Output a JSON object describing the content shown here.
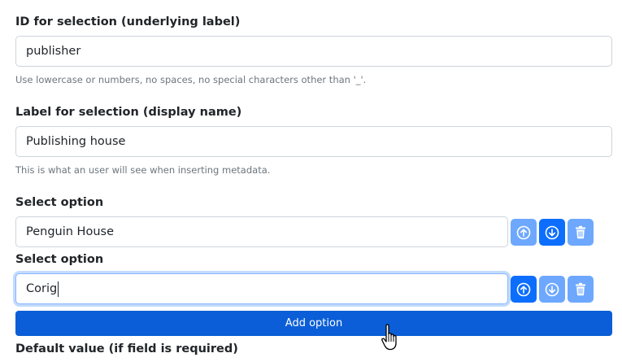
{
  "id_section": {
    "label": "ID for selection (underlying label)",
    "value": "publisher",
    "help": "Use lowercase or numbers, no spaces, no special characters other than '_'."
  },
  "label_section": {
    "label": "Label for selection (display name)",
    "value": "Publishing house",
    "help": "This is what an user will see when inserting metadata."
  },
  "options": [
    {
      "label": "Select option",
      "value": "Penguin House",
      "up_icon": "arrow-up-circle-icon",
      "down_icon": "arrow-down-circle-icon",
      "delete_icon": "trash-icon"
    },
    {
      "label": "Select option",
      "value": "Corig",
      "up_icon": "arrow-up-circle-icon",
      "down_icon": "arrow-down-circle-icon",
      "delete_icon": "trash-icon"
    }
  ],
  "add_option_label": "Add option",
  "default_value_label": "Default value (if field is required)",
  "colors": {
    "primary": "#0d6efd",
    "primary_disabled": "#6ea8fe",
    "add_button": "#0b5ed7",
    "help_text": "#6c757d",
    "border": "#ced4da"
  }
}
